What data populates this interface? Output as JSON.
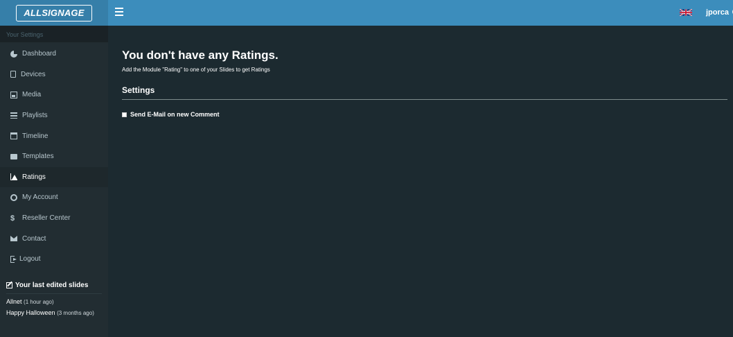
{
  "brand": {
    "logo_text": "ALLSIGNAGE"
  },
  "header": {
    "username": "jporca",
    "language_flag": "uk-flag-icon",
    "colors": {
      "topbar": "#3c8dbc",
      "logo_bg": "#367fa9"
    }
  },
  "sidebar": {
    "header": "Your Settings",
    "items": [
      {
        "label": "Dashboard",
        "icon": "pie-chart-icon"
      },
      {
        "label": "Devices",
        "icon": "tablet-icon"
      },
      {
        "label": "Media",
        "icon": "image-icon"
      },
      {
        "label": "Playlists",
        "icon": "list-icon"
      },
      {
        "label": "Timeline",
        "icon": "calendar-icon"
      },
      {
        "label": "Templates",
        "icon": "folder-icon"
      },
      {
        "label": "Ratings",
        "icon": "area-chart-icon",
        "active": true
      },
      {
        "label": "My Account",
        "icon": "user-circle-icon"
      },
      {
        "label": "Reseller Center",
        "icon": "dollar-icon"
      },
      {
        "label": "Contact",
        "icon": "envelope-icon"
      },
      {
        "label": "Logout",
        "icon": "sign-out-icon"
      }
    ],
    "recent": {
      "title": "Your last edited slides",
      "items": [
        {
          "name": "Allnet",
          "time": "(1 hour ago)"
        },
        {
          "name": "Happy Halloween",
          "time": "(3 months ago)"
        }
      ]
    }
  },
  "main": {
    "title": "You don't have any Ratings.",
    "subtitle": "Add the Module \"Rating\" to one of your Slides to get Ratings",
    "settings_heading": "Settings",
    "checkbox_label": "Send E-Mail on new Comment",
    "checkbox_checked": false
  }
}
